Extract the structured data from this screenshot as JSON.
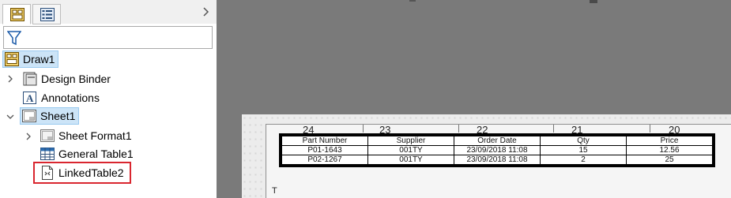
{
  "tree": {
    "root": "Draw1",
    "items": [
      {
        "label": "Design Binder"
      },
      {
        "label": "Annotations"
      },
      {
        "label": "Sheet1"
      },
      {
        "label": "Sheet Format1"
      },
      {
        "label": "General Table1"
      },
      {
        "label": "LinkedTable2"
      }
    ]
  },
  "drawing": {
    "zones": [
      "24",
      "23",
      "22",
      "21",
      "20"
    ],
    "corner_letter": "T",
    "table": {
      "headers": [
        "Part Number",
        "Supplier",
        "Order Date",
        "Qty",
        "Price"
      ],
      "rows": [
        [
          "P01-1643",
          "001TY",
          "23/09/2018 11:08",
          "15",
          "12.56"
        ],
        [
          "P02-1267",
          "001TY",
          "23/09/2018 11:08",
          "2",
          "25"
        ]
      ]
    }
  },
  "colors": {
    "selection_bg": "#cce4f7",
    "highlight_border": "#d9262f",
    "background": "#7a7a7a"
  }
}
